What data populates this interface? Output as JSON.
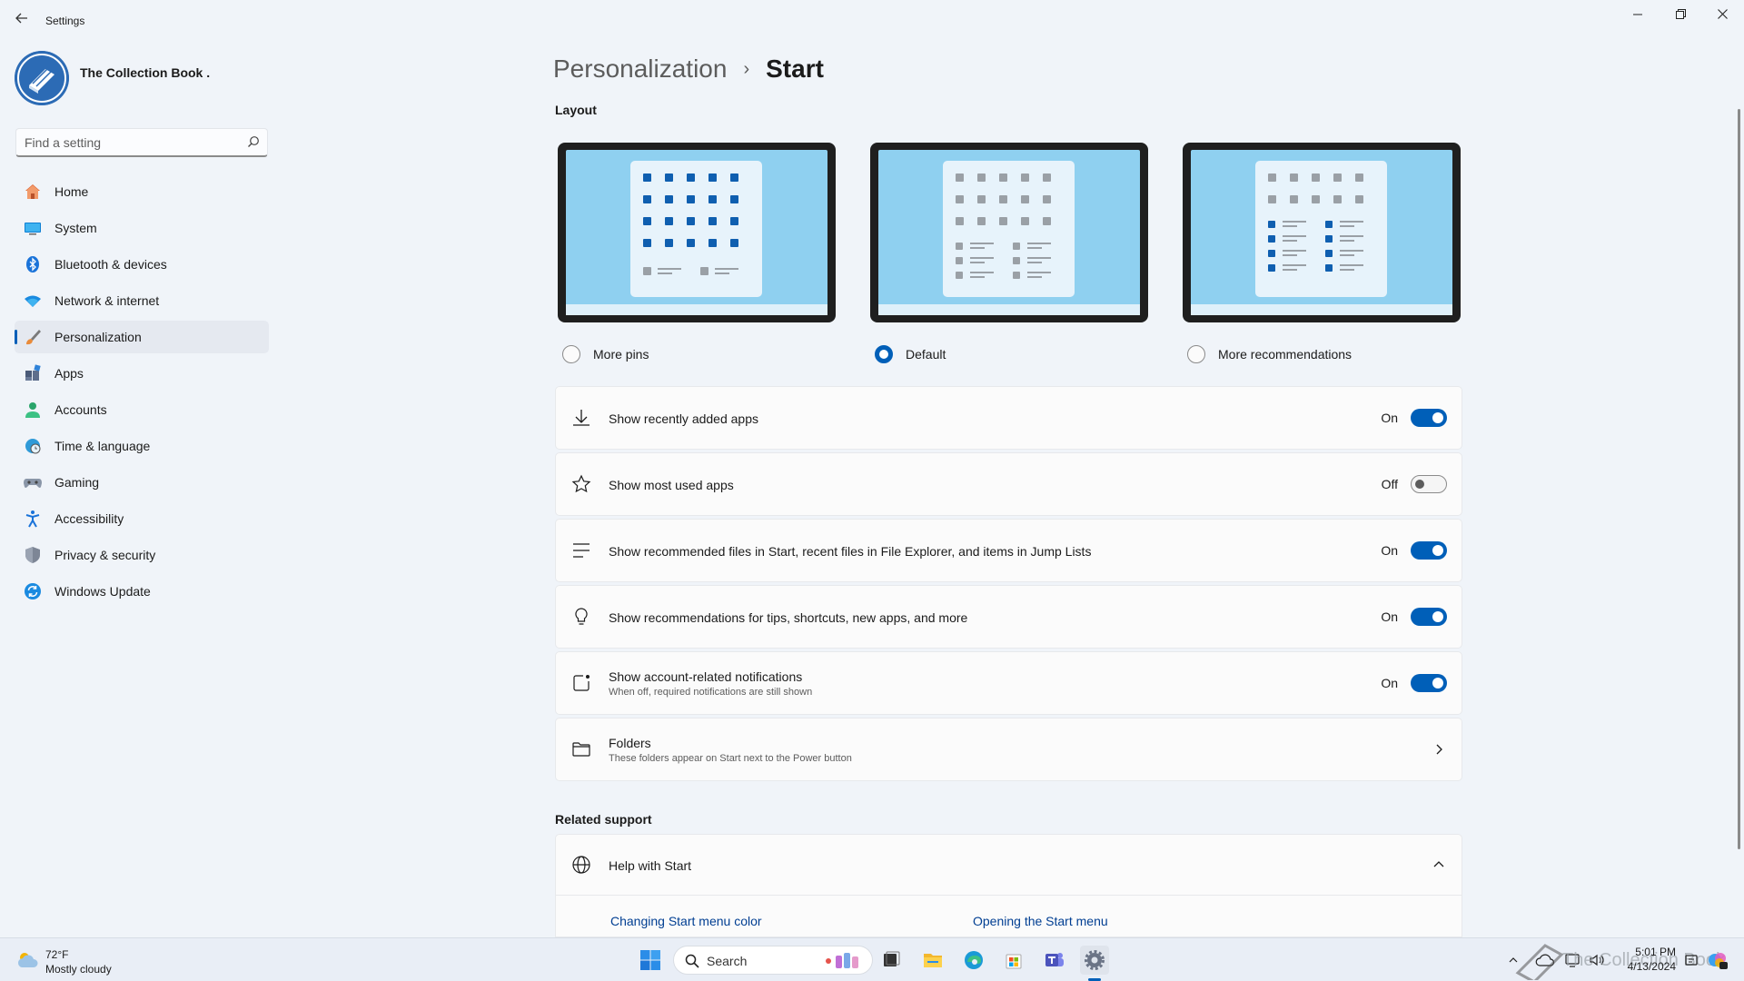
{
  "window": {
    "title": "Settings"
  },
  "profile": {
    "name": "The Collection Book ."
  },
  "search": {
    "placeholder": "Find a setting"
  },
  "sidebar": {
    "items": [
      {
        "label": "Home"
      },
      {
        "label": "System"
      },
      {
        "label": "Bluetooth & devices"
      },
      {
        "label": "Network & internet"
      },
      {
        "label": "Personalization"
      },
      {
        "label": "Apps"
      },
      {
        "label": "Accounts"
      },
      {
        "label": "Time & language"
      },
      {
        "label": "Gaming"
      },
      {
        "label": "Accessibility"
      },
      {
        "label": "Privacy & security"
      },
      {
        "label": "Windows Update"
      }
    ],
    "active": "Personalization"
  },
  "breadcrumb": {
    "parent": "Personalization",
    "separator": "›",
    "current": "Start"
  },
  "layout": {
    "label": "Layout",
    "options": [
      {
        "label": "More pins",
        "selected": false
      },
      {
        "label": "Default",
        "selected": true
      },
      {
        "label": "More recommendations",
        "selected": false
      }
    ]
  },
  "settings": [
    {
      "title": "Show recently added apps",
      "state": "On",
      "icon": "download-icon"
    },
    {
      "title": "Show most used apps",
      "state": "Off",
      "icon": "star-icon"
    },
    {
      "title": "Show recommended files in Start, recent files in File Explorer, and items in Jump Lists",
      "state": "On",
      "icon": "list-icon"
    },
    {
      "title": "Show recommendations for tips, shortcuts, new apps, and more",
      "state": "On",
      "icon": "lightbulb-icon"
    },
    {
      "title": "Show account-related notifications",
      "subtitle": "When off, required notifications are still shown",
      "state": "On",
      "icon": "notification-icon"
    },
    {
      "title": "Folders",
      "subtitle": "These folders appear on Start next to the Power button",
      "icon": "folder-icon"
    }
  ],
  "related": {
    "label": "Related support",
    "help_title": "Help with Start",
    "links": [
      "Changing Start menu color",
      "Opening the Start menu"
    ]
  },
  "taskbar": {
    "weather": {
      "temp": "72°F",
      "condition": "Mostly cloudy"
    },
    "search_label": "Search",
    "time": "5:01 PM",
    "date": "4/13/2024",
    "watermark": "The Collection Book"
  },
  "colors": {
    "accent": "#005fb8",
    "background": "#f0f4f9",
    "card": "#fbfbfb"
  }
}
